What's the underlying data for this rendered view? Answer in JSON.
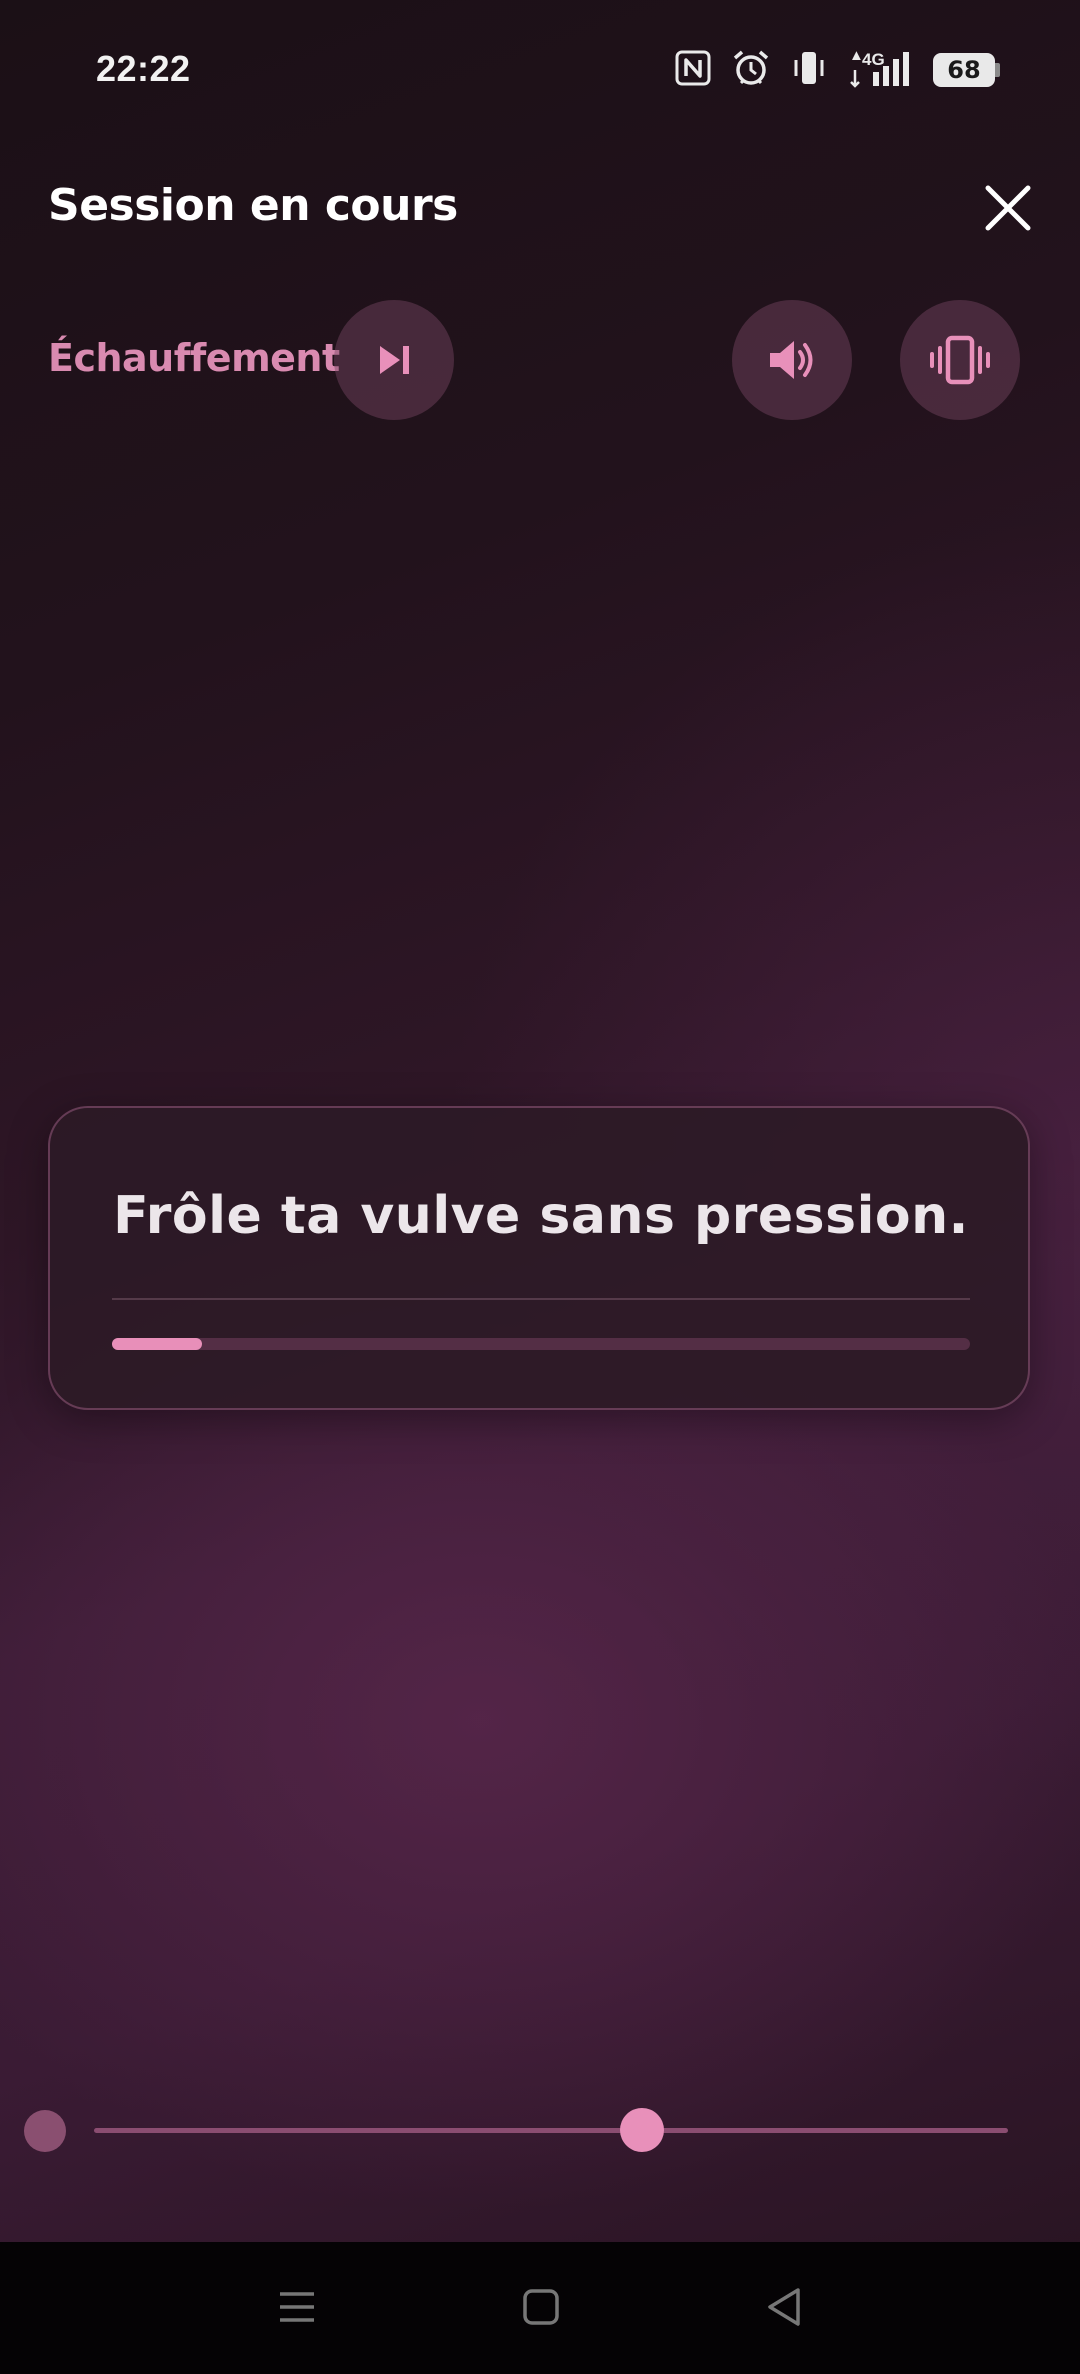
{
  "status_bar": {
    "time": "22:22",
    "network_label": "4G",
    "battery": "68",
    "icons": [
      "nfc-icon",
      "alarm-icon",
      "vibrate-mode-icon",
      "signal-icon",
      "battery-icon"
    ]
  },
  "header": {
    "title": "Session en cours",
    "close_icon": "close-icon"
  },
  "controls": {
    "phase_label": "Échauffement",
    "skip_icon": "skip-next-icon",
    "sound_icon": "volume-icon",
    "vibrate_icon": "vibrate-icon"
  },
  "instruction": {
    "text": "Frôle ta vulve sans pression.",
    "progress": 0.105
  },
  "intensity_slider": {
    "value": 0.6
  },
  "colors": {
    "accent": "#e890ba",
    "phase_label": "#d98ab0",
    "card_background": "#2c1a26",
    "background_top": "#1b1016",
    "background_mid": "#3b1c35"
  },
  "nav_bar": {
    "icons": [
      "menu-icon",
      "home-icon",
      "back-icon"
    ]
  }
}
